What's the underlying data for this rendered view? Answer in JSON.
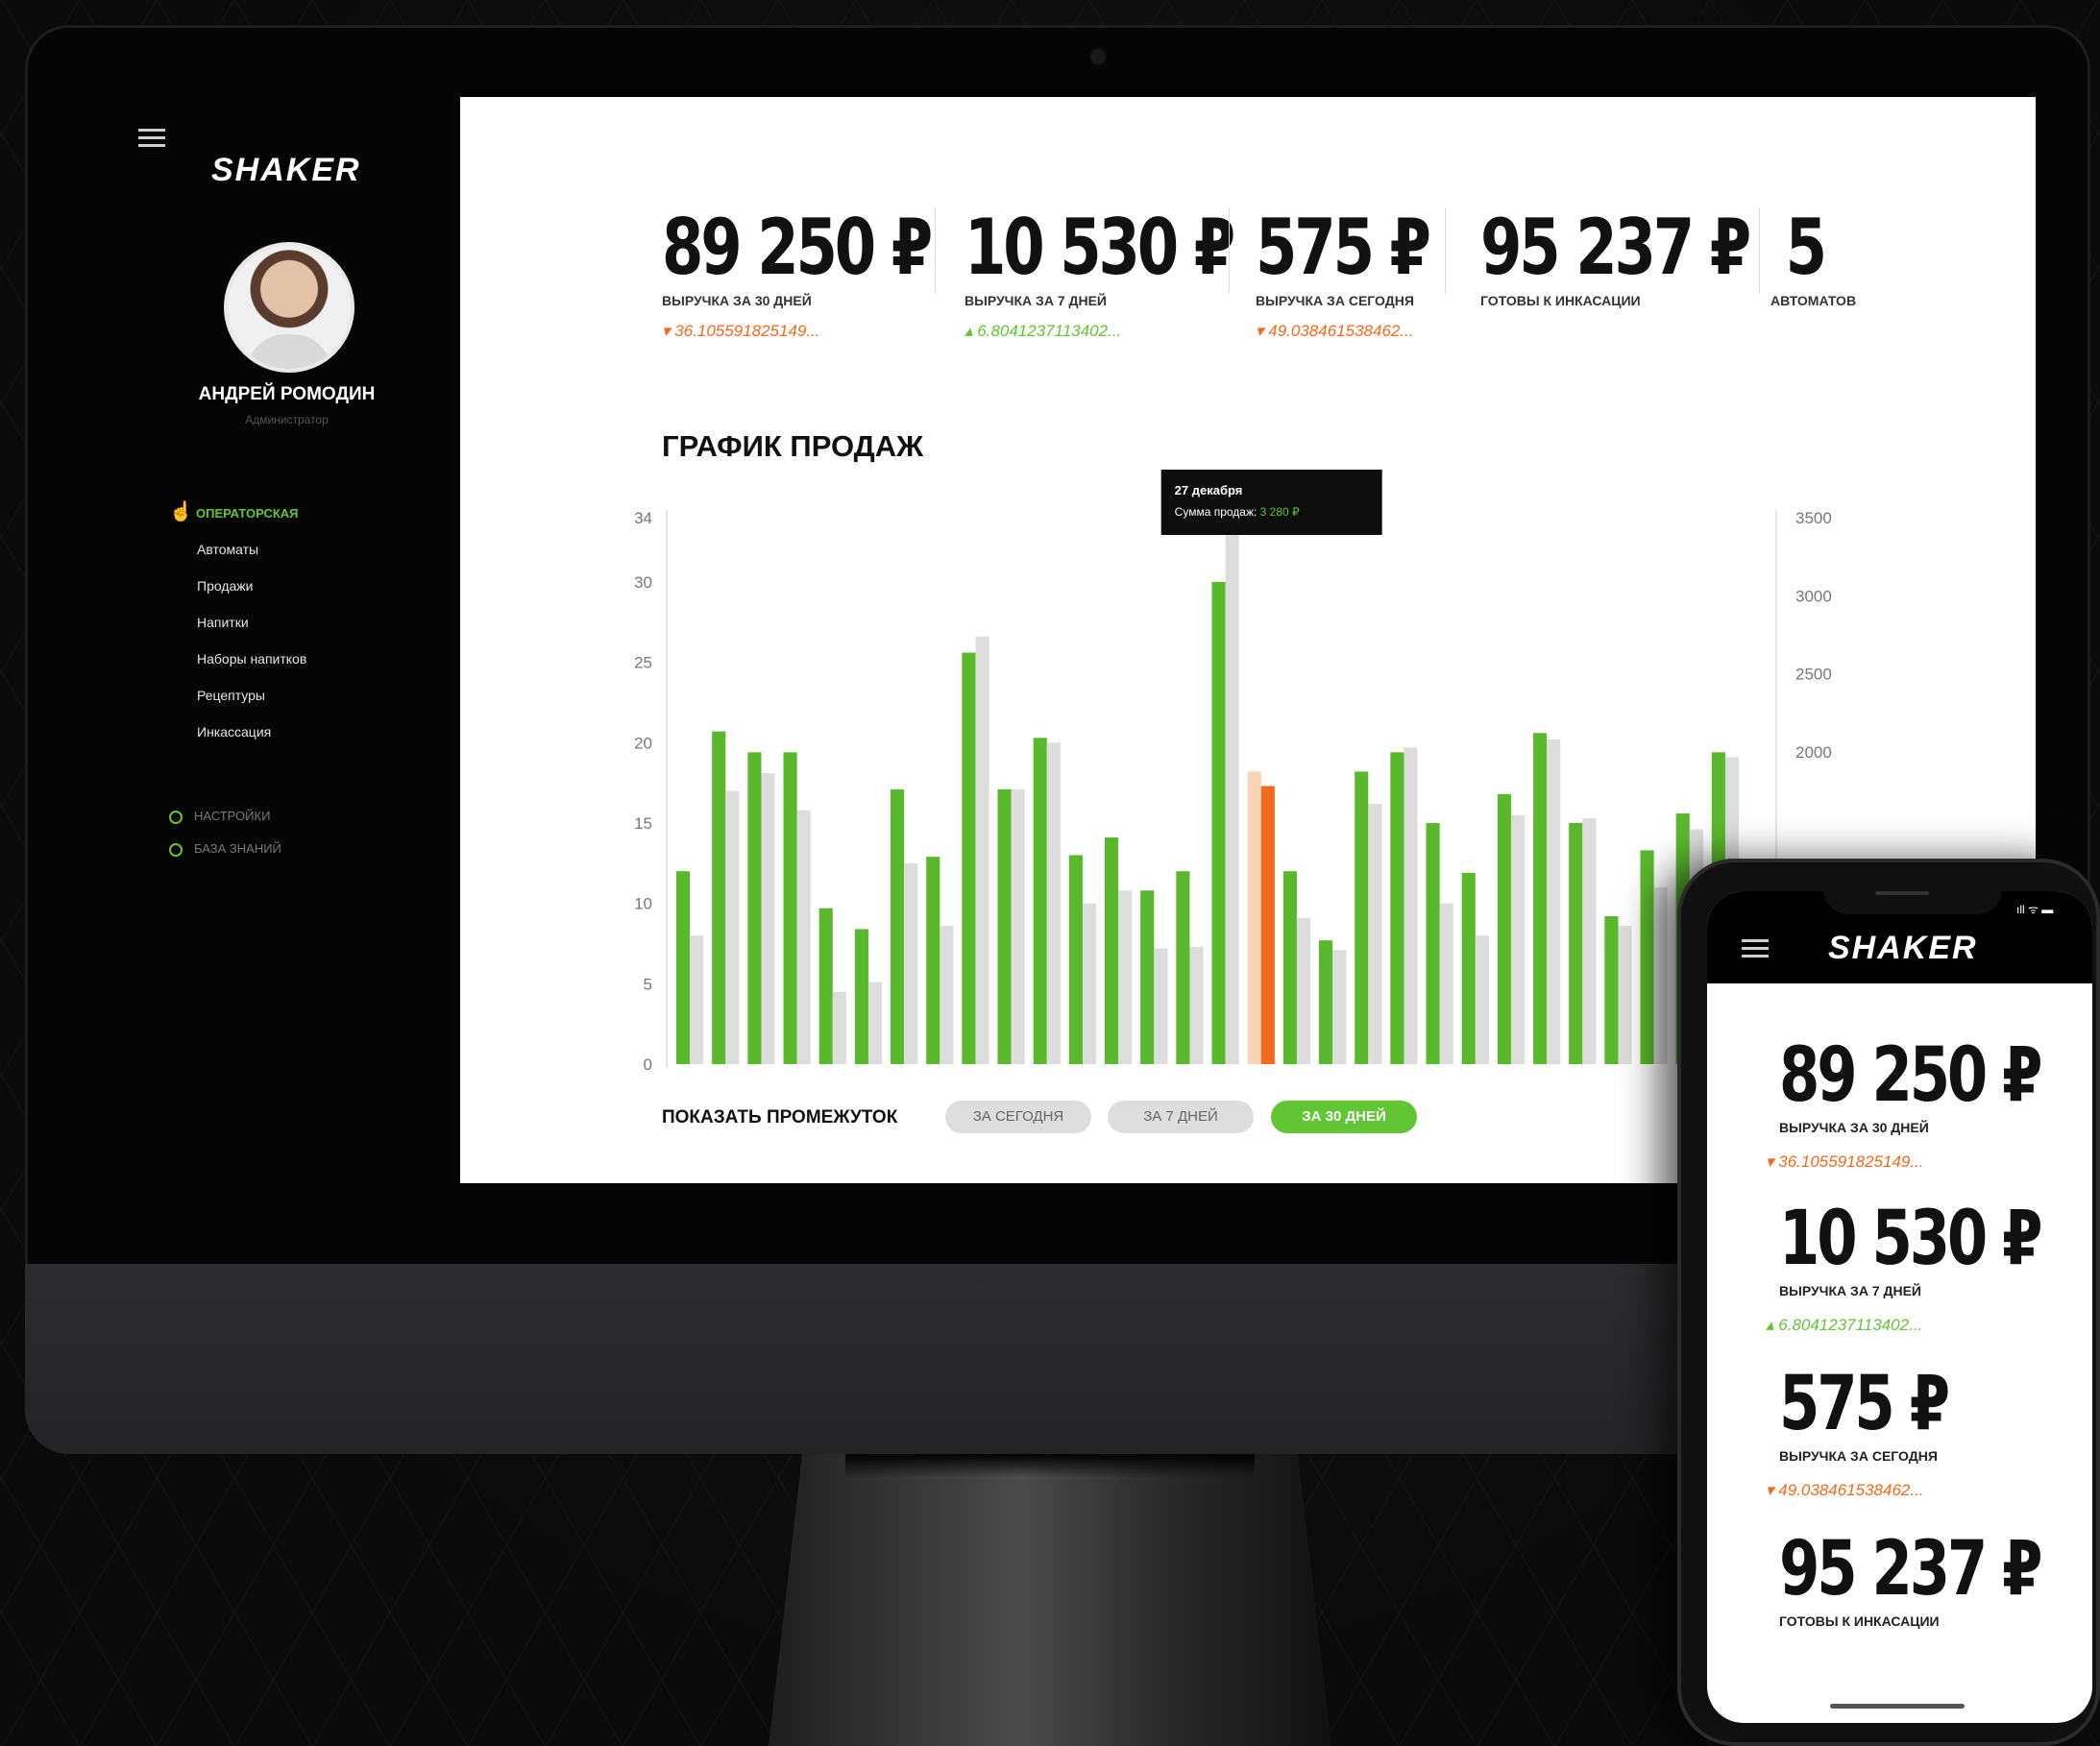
{
  "app": {
    "brand": "SHAKER"
  },
  "sidebar": {
    "user_name": "АНДРЕЙ РОМОДИН",
    "user_role": "Администратор",
    "section_title": "ОПЕРАТОРСКАЯ",
    "items": [
      {
        "label": "Автоматы"
      },
      {
        "label": "Продажи"
      },
      {
        "label": "Напитки"
      },
      {
        "label": "Наборы напитков"
      },
      {
        "label": "Рецептуры"
      },
      {
        "label": "Инкассация"
      }
    ],
    "settings_label": "НАСТРОЙКИ",
    "knowledge_label": "БАЗА ЗНАНИЙ"
  },
  "kpis": [
    {
      "value": "89 250 ₽",
      "label": "ВЫРУЧКА ЗА 30 ДНЕЙ",
      "delta": "36.105591825149...",
      "trend": "down"
    },
    {
      "value": "10 530 ₽",
      "label": "ВЫРУЧКА ЗА 7 ДНЕЙ",
      "delta": "6.8041237113402...",
      "trend": "up"
    },
    {
      "value": "575 ₽",
      "label": "ВЫРУЧКА ЗА СЕГОДНЯ",
      "delta": "49.038461538462...",
      "trend": "down"
    },
    {
      "value": "95 237 ₽",
      "label": "ГОТОВЫ К ИНКАСАЦИИ"
    },
    {
      "value": "5",
      "label": "АВТОМАТОВ"
    }
  ],
  "chart": {
    "title": "ГРАФИК ПРОДАЖ",
    "tooltip_date": "27 декабря",
    "tooltip_label": "Сумма продаж:",
    "tooltip_value": "3 280 ₽"
  },
  "range": {
    "label": "ПОКАЗАТЬ ПРОМЕЖУТОК",
    "buttons": [
      {
        "label": "ЗА СЕГОДНЯ"
      },
      {
        "label": "ЗА 7 ДНЕЙ"
      },
      {
        "label": "ЗА 30 ДНЕЙ"
      }
    ]
  },
  "colors": {
    "accent": "#61c534",
    "down": "#f06a1b",
    "highlight": "#f26b1d"
  },
  "chart_data": {
    "type": "bar",
    "y_left_ticks": [
      "0",
      "5",
      "10",
      "15",
      "20",
      "25",
      "30",
      "34"
    ],
    "y_right_ticks": [
      "2000",
      "2500",
      "3000",
      "3500"
    ],
    "ylim": [
      0,
      34
    ],
    "highlight_index": 16,
    "series": [
      {
        "values": [
          12,
          20.7,
          19.4,
          19.4,
          9.7,
          8.4,
          17.1,
          12.9,
          25.6,
          17.1,
          20.3,
          13.0,
          14.1,
          10.8,
          12.0,
          30.0,
          18.2,
          12.0,
          7.7,
          18.2,
          19.4,
          15.0,
          11.9,
          16.8,
          20.6,
          15.0,
          9.2,
          13.3,
          15.6,
          19.4
        ]
      },
      {
        "values": [
          8.0,
          17.0,
          18.1,
          15.8,
          4.5,
          5.1,
          12.5,
          8.6,
          26.6,
          17.1,
          20.0,
          10.0,
          10.8,
          7.2,
          7.3,
          34.0,
          17.3,
          9.1,
          7.1,
          16.2,
          19.7,
          10.0,
          8.0,
          15.5,
          20.2,
          15.3,
          8.6,
          11.0,
          14.6,
          19.1
        ]
      }
    ]
  },
  "phone": {
    "status": "ıll ᯤ ▬",
    "kpis": [
      {
        "value": "89 250 ₽",
        "label": "ВЫРУЧКА ЗА 30 ДНЕЙ",
        "delta": "36.105591825149...",
        "trend": "down"
      },
      {
        "value": "10 530 ₽",
        "label": "ВЫРУЧКА ЗА 7 ДНЕЙ",
        "delta": "6.8041237113402...",
        "trend": "up"
      },
      {
        "value": "575 ₽",
        "label": "ВЫРУЧКА ЗА СЕГОДНЯ",
        "delta": "49.038461538462...",
        "trend": "down"
      },
      {
        "value": "95 237 ₽",
        "label": "ГОТОВЫ К ИНКАСАЦИИ"
      }
    ]
  }
}
